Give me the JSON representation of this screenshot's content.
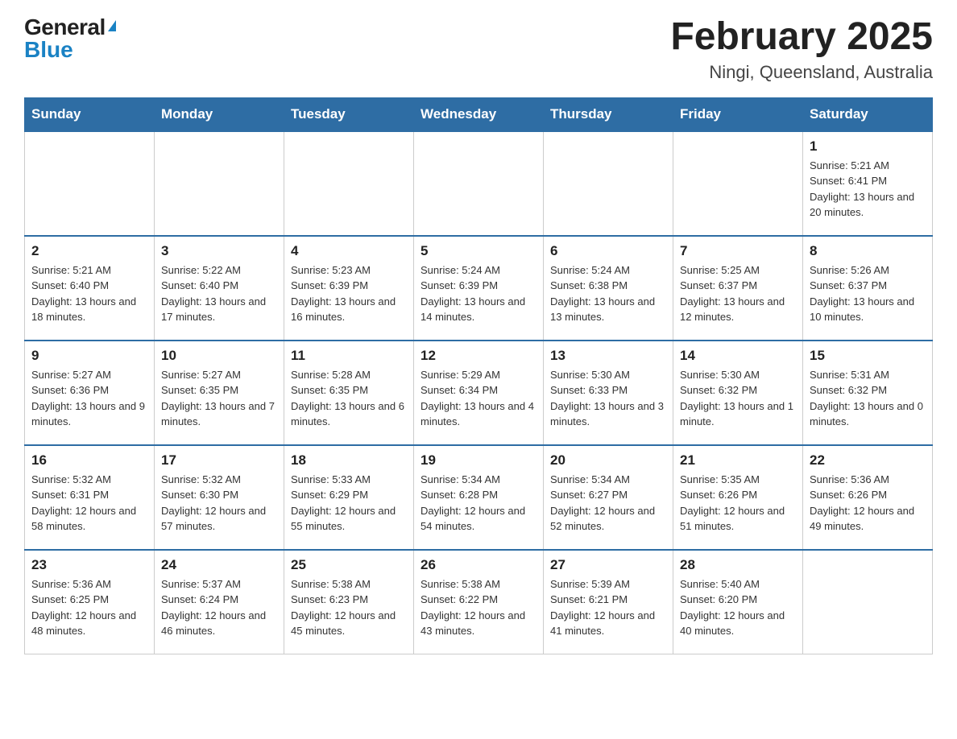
{
  "header": {
    "logo_general": "General",
    "logo_blue": "Blue",
    "title": "February 2025",
    "subtitle": "Ningi, Queensland, Australia"
  },
  "days_of_week": [
    "Sunday",
    "Monday",
    "Tuesday",
    "Wednesday",
    "Thursday",
    "Friday",
    "Saturday"
  ],
  "weeks": [
    [
      {
        "day": "",
        "info": ""
      },
      {
        "day": "",
        "info": ""
      },
      {
        "day": "",
        "info": ""
      },
      {
        "day": "",
        "info": ""
      },
      {
        "day": "",
        "info": ""
      },
      {
        "day": "",
        "info": ""
      },
      {
        "day": "1",
        "info": "Sunrise: 5:21 AM\nSunset: 6:41 PM\nDaylight: 13 hours and 20 minutes."
      }
    ],
    [
      {
        "day": "2",
        "info": "Sunrise: 5:21 AM\nSunset: 6:40 PM\nDaylight: 13 hours and 18 minutes."
      },
      {
        "day": "3",
        "info": "Sunrise: 5:22 AM\nSunset: 6:40 PM\nDaylight: 13 hours and 17 minutes."
      },
      {
        "day": "4",
        "info": "Sunrise: 5:23 AM\nSunset: 6:39 PM\nDaylight: 13 hours and 16 minutes."
      },
      {
        "day": "5",
        "info": "Sunrise: 5:24 AM\nSunset: 6:39 PM\nDaylight: 13 hours and 14 minutes."
      },
      {
        "day": "6",
        "info": "Sunrise: 5:24 AM\nSunset: 6:38 PM\nDaylight: 13 hours and 13 minutes."
      },
      {
        "day": "7",
        "info": "Sunrise: 5:25 AM\nSunset: 6:37 PM\nDaylight: 13 hours and 12 minutes."
      },
      {
        "day": "8",
        "info": "Sunrise: 5:26 AM\nSunset: 6:37 PM\nDaylight: 13 hours and 10 minutes."
      }
    ],
    [
      {
        "day": "9",
        "info": "Sunrise: 5:27 AM\nSunset: 6:36 PM\nDaylight: 13 hours and 9 minutes."
      },
      {
        "day": "10",
        "info": "Sunrise: 5:27 AM\nSunset: 6:35 PM\nDaylight: 13 hours and 7 minutes."
      },
      {
        "day": "11",
        "info": "Sunrise: 5:28 AM\nSunset: 6:35 PM\nDaylight: 13 hours and 6 minutes."
      },
      {
        "day": "12",
        "info": "Sunrise: 5:29 AM\nSunset: 6:34 PM\nDaylight: 13 hours and 4 minutes."
      },
      {
        "day": "13",
        "info": "Sunrise: 5:30 AM\nSunset: 6:33 PM\nDaylight: 13 hours and 3 minutes."
      },
      {
        "day": "14",
        "info": "Sunrise: 5:30 AM\nSunset: 6:32 PM\nDaylight: 13 hours and 1 minute."
      },
      {
        "day": "15",
        "info": "Sunrise: 5:31 AM\nSunset: 6:32 PM\nDaylight: 13 hours and 0 minutes."
      }
    ],
    [
      {
        "day": "16",
        "info": "Sunrise: 5:32 AM\nSunset: 6:31 PM\nDaylight: 12 hours and 58 minutes."
      },
      {
        "day": "17",
        "info": "Sunrise: 5:32 AM\nSunset: 6:30 PM\nDaylight: 12 hours and 57 minutes."
      },
      {
        "day": "18",
        "info": "Sunrise: 5:33 AM\nSunset: 6:29 PM\nDaylight: 12 hours and 55 minutes."
      },
      {
        "day": "19",
        "info": "Sunrise: 5:34 AM\nSunset: 6:28 PM\nDaylight: 12 hours and 54 minutes."
      },
      {
        "day": "20",
        "info": "Sunrise: 5:34 AM\nSunset: 6:27 PM\nDaylight: 12 hours and 52 minutes."
      },
      {
        "day": "21",
        "info": "Sunrise: 5:35 AM\nSunset: 6:26 PM\nDaylight: 12 hours and 51 minutes."
      },
      {
        "day": "22",
        "info": "Sunrise: 5:36 AM\nSunset: 6:26 PM\nDaylight: 12 hours and 49 minutes."
      }
    ],
    [
      {
        "day": "23",
        "info": "Sunrise: 5:36 AM\nSunset: 6:25 PM\nDaylight: 12 hours and 48 minutes."
      },
      {
        "day": "24",
        "info": "Sunrise: 5:37 AM\nSunset: 6:24 PM\nDaylight: 12 hours and 46 minutes."
      },
      {
        "day": "25",
        "info": "Sunrise: 5:38 AM\nSunset: 6:23 PM\nDaylight: 12 hours and 45 minutes."
      },
      {
        "day": "26",
        "info": "Sunrise: 5:38 AM\nSunset: 6:22 PM\nDaylight: 12 hours and 43 minutes."
      },
      {
        "day": "27",
        "info": "Sunrise: 5:39 AM\nSunset: 6:21 PM\nDaylight: 12 hours and 41 minutes."
      },
      {
        "day": "28",
        "info": "Sunrise: 5:40 AM\nSunset: 6:20 PM\nDaylight: 12 hours and 40 minutes."
      },
      {
        "day": "",
        "info": ""
      }
    ]
  ]
}
